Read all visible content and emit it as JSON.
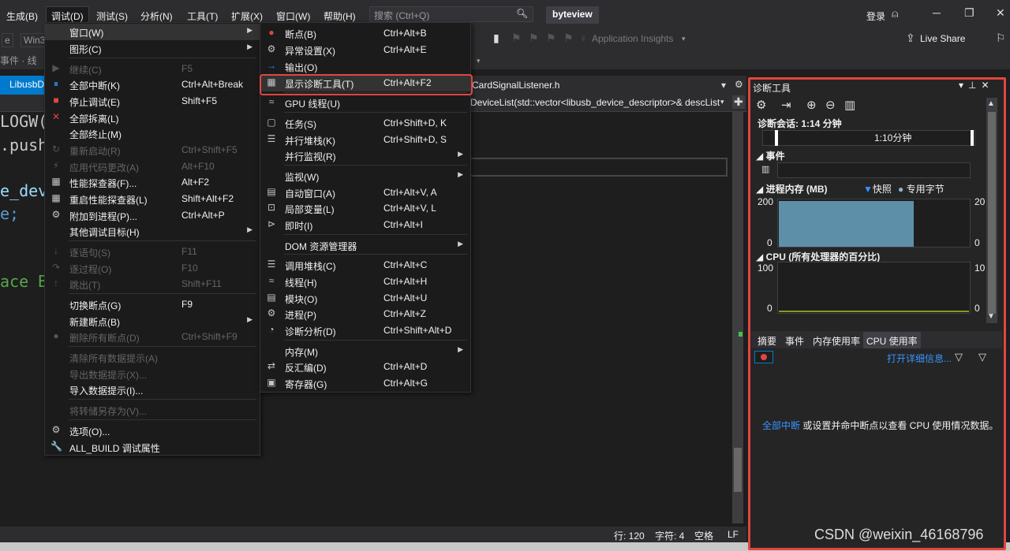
{
  "menubar": {
    "items": [
      "生成(B)",
      "调试(D)",
      "测试(S)",
      "分析(N)",
      "工具(T)",
      "扩展(X)",
      "窗口(W)",
      "帮助(H)"
    ],
    "search_placeholder": "搜索 (Ctrl+Q)",
    "project_name": "byteview",
    "login": "登录"
  },
  "toolbar": {
    "platform_partial": "Win3",
    "events_partial": "事件 · 线",
    "app_insights": "Application Insights",
    "live_share": "Live Share"
  },
  "editor": {
    "tab_left": "LibusbD",
    "tab_right": "CardSignalListener.h",
    "nav_text": "DeviceList(std::vector<libusb_device_descriptor>& descList",
    "code_lines": [
      {
        "text": "LOGW(",
        "color": "#c8c8c8"
      },
      {
        "text": ".push",
        "color": "#c8c8c8"
      },
      {
        "text": "e_dev",
        "color": "#9cdcfe"
      },
      {
        "text": "e;",
        "color": "#569cd6"
      },
      {
        "text": "ace B",
        "color": "#57a64a"
      }
    ]
  },
  "status": {
    "line": "行: 120",
    "char": "字符: 4",
    "space": "空格",
    "eol": "LF"
  },
  "debug_menu": {
    "items": [
      {
        "label": "窗口(W)",
        "shortcut": "",
        "icon": "",
        "arrow": true,
        "disabled": false,
        "highlight": true
      },
      {
        "label": "图形(C)",
        "shortcut": "",
        "icon": "",
        "arrow": true,
        "disabled": false
      },
      {
        "label": "继续(C)",
        "shortcut": "F5",
        "icon": "▶",
        "disabled": true
      },
      {
        "label": "全部中断(K)",
        "shortcut": "Ctrl+Alt+Break",
        "icon": "⏸",
        "disabled": false
      },
      {
        "label": "停止调试(E)",
        "shortcut": "Shift+F5",
        "icon": "■",
        "disabled": false
      },
      {
        "label": "全部拆离(L)",
        "shortcut": "",
        "icon": "✕",
        "disabled": false
      },
      {
        "label": "全部终止(M)",
        "shortcut": "",
        "icon": "",
        "disabled": false
      },
      {
        "label": "重新启动(R)",
        "shortcut": "Ctrl+Shift+F5",
        "icon": "↻",
        "disabled": true
      },
      {
        "label": "应用代码更改(A)",
        "shortcut": "Alt+F10",
        "icon": "⚡",
        "disabled": true
      },
      {
        "label": "性能探查器(F)...",
        "shortcut": "Alt+F2",
        "icon": "▦",
        "disabled": false
      },
      {
        "label": "重启性能探查器(L)",
        "shortcut": "Shift+Alt+F2",
        "icon": "▦",
        "disabled": false
      },
      {
        "label": "附加到进程(P)...",
        "shortcut": "Ctrl+Alt+P",
        "icon": "⚙",
        "disabled": false
      },
      {
        "label": "其他调试目标(H)",
        "shortcut": "",
        "icon": "",
        "arrow": true,
        "disabled": false
      },
      {
        "label": "逐语句(S)",
        "shortcut": "F11",
        "icon": "↓",
        "disabled": true
      },
      {
        "label": "逐过程(O)",
        "shortcut": "F10",
        "icon": "↷",
        "disabled": true
      },
      {
        "label": "跳出(T)",
        "shortcut": "Shift+F11",
        "icon": "↑",
        "disabled": true
      },
      {
        "label": "切换断点(G)",
        "shortcut": "F9",
        "icon": "",
        "disabled": false
      },
      {
        "label": "新建断点(B)",
        "shortcut": "",
        "icon": "",
        "arrow": true,
        "disabled": false
      },
      {
        "label": "删除所有断点(D)",
        "shortcut": "Ctrl+Shift+F9",
        "icon": "●",
        "disabled": true
      },
      {
        "label": "清除所有数据提示(A)",
        "shortcut": "",
        "icon": "",
        "disabled": true
      },
      {
        "label": "导出数据提示(X)...",
        "shortcut": "",
        "icon": "",
        "disabled": true
      },
      {
        "label": "导入数据提示(I)...",
        "shortcut": "",
        "icon": "",
        "disabled": false
      },
      {
        "label": "将转储另存为(V)...",
        "shortcut": "",
        "icon": "",
        "disabled": true
      },
      {
        "label": "选项(O)...",
        "shortcut": "",
        "icon": "⚙",
        "disabled": false
      },
      {
        "label": "ALL_BUILD 调试属性",
        "shortcut": "",
        "icon": "🔧",
        "disabled": false
      }
    ]
  },
  "window_menu": {
    "items": [
      {
        "label": "断点(B)",
        "shortcut": "Ctrl+Alt+B",
        "icon": "●"
      },
      {
        "label": "异常设置(X)",
        "shortcut": "Ctrl+Alt+E",
        "icon": "⚙"
      },
      {
        "label": "输出(O)",
        "shortcut": "",
        "icon": "→"
      },
      {
        "label": "显示诊断工具(T)",
        "shortcut": "Ctrl+Alt+F2",
        "icon": "▦",
        "highlight": true
      },
      {
        "label": "GPU 线程(U)",
        "shortcut": "",
        "icon": "≈"
      },
      {
        "label": "任务(S)",
        "shortcut": "Ctrl+Shift+D, K",
        "icon": "▢"
      },
      {
        "label": "并行堆栈(K)",
        "shortcut": "Ctrl+Shift+D, S",
        "icon": "☰"
      },
      {
        "label": "并行监视(R)",
        "shortcut": "",
        "icon": "",
        "arrow": true
      },
      {
        "label": "监视(W)",
        "shortcut": "",
        "icon": "",
        "arrow": true
      },
      {
        "label": "自动窗口(A)",
        "shortcut": "Ctrl+Alt+V, A",
        "icon": "▤"
      },
      {
        "label": "局部变量(L)",
        "shortcut": "Ctrl+Alt+V, L",
        "icon": "⊡"
      },
      {
        "label": "即时(I)",
        "shortcut": "Ctrl+Alt+I",
        "icon": "⊳"
      },
      {
        "label": "DOM 资源管理器",
        "shortcut": "",
        "icon": "",
        "arrow": true
      },
      {
        "label": "调用堆栈(C)",
        "shortcut": "Ctrl+Alt+C",
        "icon": "☰"
      },
      {
        "label": "线程(H)",
        "shortcut": "Ctrl+Alt+H",
        "icon": "≈"
      },
      {
        "label": "模块(O)",
        "shortcut": "Ctrl+Alt+U",
        "icon": "▤"
      },
      {
        "label": "进程(P)",
        "shortcut": "Ctrl+Alt+Z",
        "icon": "⚙"
      },
      {
        "label": "诊断分析(D)",
        "shortcut": "Ctrl+Shift+Alt+D",
        "icon": "◔"
      },
      {
        "label": "内存(M)",
        "shortcut": "",
        "icon": "",
        "arrow": true
      },
      {
        "label": "反汇编(D)",
        "shortcut": "Ctrl+Alt+D",
        "icon": "⇄"
      },
      {
        "label": "寄存器(G)",
        "shortcut": "Ctrl+Alt+G",
        "icon": "▣"
      }
    ]
  },
  "diag": {
    "title": "诊断工具",
    "session": "诊断会话: 1:14 分钟",
    "timeline_label": "1:10分钟",
    "events_title": "事件",
    "memory_title": "进程内存 (MB)",
    "legend_snapshot": "快照",
    "legend_dedicated": "专用字节",
    "mem_max": "200",
    "mem_min": "0",
    "mem_max_right": "20",
    "mem_min_right": "0",
    "cpu_title": "CPU (所有处理器的百分比)",
    "cpu_max": "100",
    "cpu_min": "0",
    "cpu_max_right": "10",
    "cpu_min_right": "0",
    "tabs": [
      "摘要",
      "事件",
      "内存使用率",
      "CPU 使用率"
    ],
    "open_details": "打开详细信息...",
    "cpu_msg_link": "全部中断",
    "cpu_msg_rest": " 或设置并命中断点以查看 CPU 使用情况数据。",
    "memory_value_mb": 200,
    "snapshot_color": "#3794ff",
    "dedicated_color": "#5e8fa8"
  },
  "watermark": "CSDN @weixin_46168796"
}
